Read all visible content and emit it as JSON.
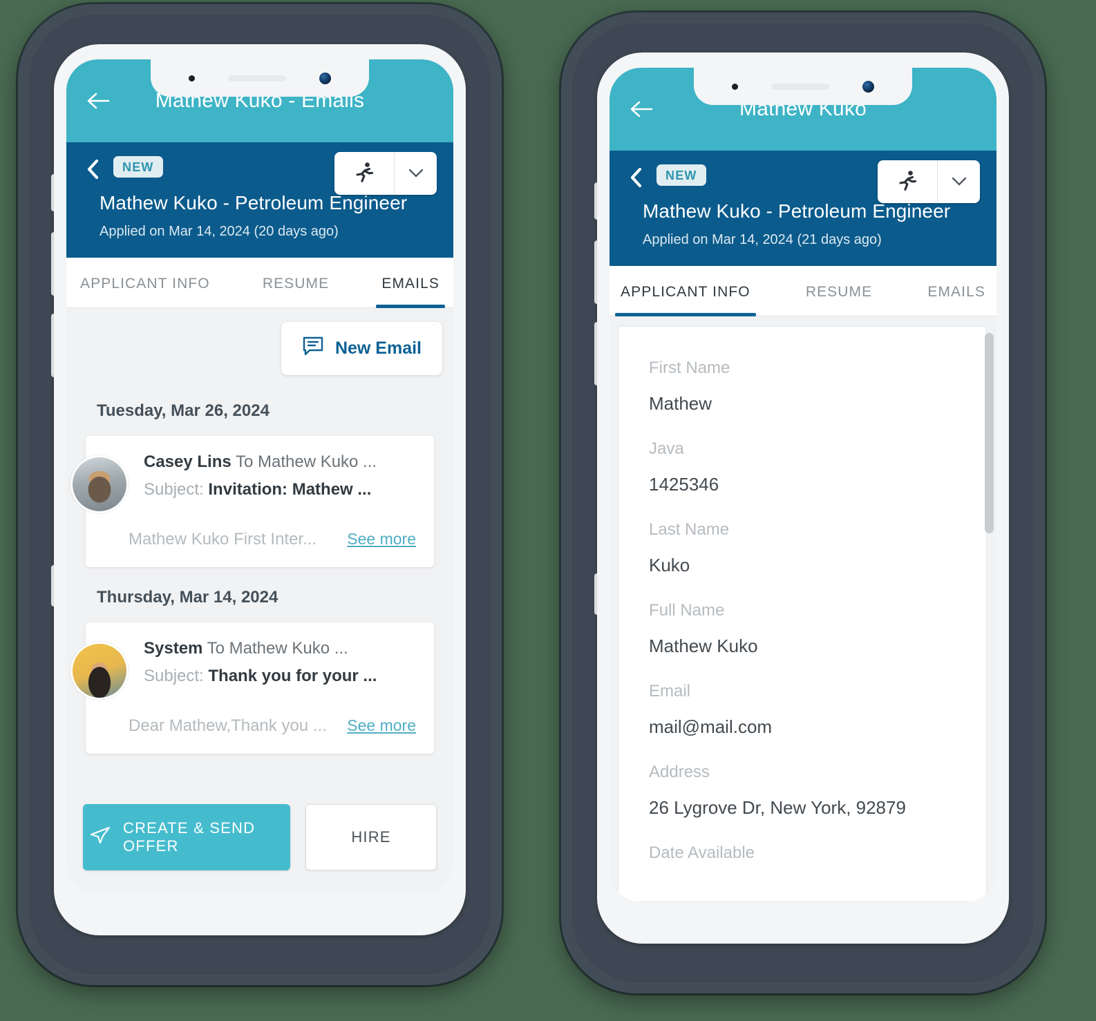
{
  "theme": {
    "appbar": "#3eb4c6",
    "subheader": "#0b5b8c",
    "accent_teal": "#45bccd",
    "accent_blue": "#0e6194",
    "page_background": "#4a6b52"
  },
  "phones": [
    {
      "id": "left-phone",
      "appbar": {
        "back_icon": "arrow-left-icon",
        "title": "Mathew Kuko - Emails"
      },
      "subheader": {
        "back_icon": "chevron-left-icon",
        "badge": "NEW",
        "stage_icon": "running-person-icon",
        "dropdown_icon": "chevron-down-icon",
        "title": "Mathew Kuko - Petroleum Engineer",
        "meta": "Applied on Mar 14, 2024 (20 days ago)"
      },
      "tabs": [
        {
          "label": "APPLICANT INFO",
          "active": false
        },
        {
          "label": "RESUME",
          "active": false
        },
        {
          "label": "EMAILS",
          "active": true
        }
      ],
      "emails_tab": {
        "new_email_label": "New Email",
        "new_email_icon": "message-icon",
        "groups": [
          {
            "day": "Tuesday, Mar 26, 2024",
            "emails": [
              {
                "avatar": "avatar-casey-lins",
                "from": "Casey Lins",
                "to": "To Mathew Kuko ...",
                "subject_label": "Subject:",
                "subject": "Invitation: Mathew ...",
                "preview": "Mathew Kuko First Inter...",
                "see_more": "See more"
              }
            ]
          },
          {
            "day": "Thursday, Mar 14, 2024",
            "emails": [
              {
                "avatar": "avatar-system",
                "from": "System",
                "to": "To Mathew Kuko ...",
                "subject_label": "Subject:",
                "subject": "Thank you for your ...",
                "preview": "Dear Mathew,Thank you ...",
                "see_more": "See more"
              }
            ]
          }
        ]
      },
      "actions": {
        "offer_label": "CREATE & SEND OFFER",
        "offer_icon": "send-icon",
        "hire_label": "HIRE"
      }
    },
    {
      "id": "right-phone",
      "appbar": {
        "back_icon": "arrow-left-icon",
        "title": "Mathew Kuko"
      },
      "subheader": {
        "back_icon": "chevron-left-icon",
        "badge": "NEW",
        "stage_icon": "running-person-icon",
        "dropdown_icon": "chevron-down-icon",
        "title": "Mathew Kuko - Petroleum Engineer",
        "meta": "Applied on Mar 14, 2024 (21 days ago)"
      },
      "tabs": [
        {
          "label": "APPLICANT INFO",
          "active": true
        },
        {
          "label": "RESUME",
          "active": false
        },
        {
          "label": "EMAILS",
          "active": false
        }
      ],
      "applicant_info": {
        "fields": [
          {
            "label": "First Name",
            "value": "Mathew"
          },
          {
            "label": "Java",
            "value": "1425346"
          },
          {
            "label": "Last Name",
            "value": "Kuko"
          },
          {
            "label": "Full Name",
            "value": "Mathew Kuko"
          },
          {
            "label": "Email",
            "value": "mail@mail.com"
          },
          {
            "label": "Address",
            "value": "26 Lygrove Dr, New York, 92879"
          },
          {
            "label": "Date Available",
            "value": ""
          }
        ]
      }
    }
  ]
}
